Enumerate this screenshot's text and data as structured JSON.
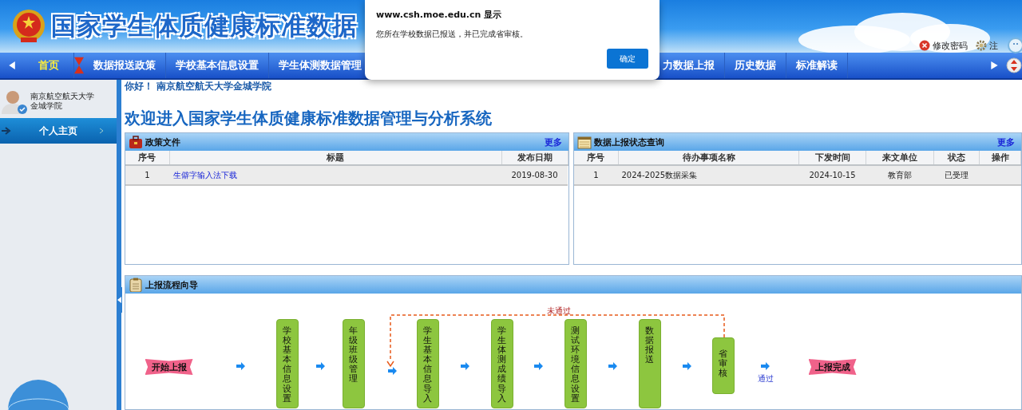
{
  "header": {
    "title": "国家学生体质健康标准数据",
    "links": [
      {
        "label": "修改密码",
        "kind": "password"
      },
      {
        "label": "注",
        "kind": "settings"
      }
    ]
  },
  "dialog": {
    "title": "www.csh.moe.edu.cn 显示",
    "message": "您所在学校数据已报送，并已完成省审核。",
    "button": "确定"
  },
  "nav": {
    "items": [
      {
        "label": "首页",
        "selected": true
      },
      {
        "label": "数据报送政策",
        "selected": false
      },
      {
        "label": "学校基本信息设置",
        "selected": false
      },
      {
        "label": "学生体测数据管理",
        "selected": false
      },
      {
        "label": "力数据上报",
        "selected": false
      },
      {
        "label": "历史数据",
        "selected": false
      },
      {
        "label": "标准解读",
        "selected": false
      }
    ]
  },
  "sidebar": {
    "user": "南京航空航天大学金城学院",
    "items": [
      {
        "label": "个人主页",
        "selected": true
      }
    ]
  },
  "greeting": "你好！ 南京航空航天大学金城学院",
  "heading": "欢迎进入国家学生体质健康标准数据管理与分析系统",
  "panels": [
    {
      "title": "政策文件",
      "kind": "toolbox",
      "more": "更多",
      "columns": [
        {
          "label": "序号",
          "kind": "index"
        },
        {
          "label": "标题",
          "kind": "link"
        },
        {
          "label": "发布日期",
          "kind": "text"
        }
      ],
      "rows": [
        [
          "1",
          "生僻字输入法下载",
          "2019-08-30"
        ]
      ]
    },
    {
      "title": "数据上报状态查询",
      "kind": "calendar",
      "more": "更多",
      "columns": [
        {
          "label": "序号",
          "kind": "index"
        },
        {
          "label": "待办事项名称",
          "kind": "name"
        },
        {
          "label": "下发时间",
          "kind": "text"
        },
        {
          "label": "来文单位",
          "kind": "text"
        },
        {
          "label": "状态",
          "kind": "text"
        },
        {
          "label": "操作",
          "kind": "text"
        }
      ],
      "rows": [
        [
          "1",
          "2024-2025数据采集",
          "2024-10-15",
          "教育部",
          "已受理"
        ]
      ]
    }
  ],
  "flow": {
    "title": "上报流程向导",
    "nodes": [
      {
        "kind": "start",
        "label": "开始上报"
      },
      {
        "kind": "step",
        "label": "学校基本信息设置"
      },
      {
        "kind": "step",
        "label": "年级班级管理"
      },
      {
        "kind": "step",
        "label": "学生基本信息导入"
      },
      {
        "kind": "step",
        "label": "学生体测成绩导入"
      },
      {
        "kind": "step",
        "label": "测试环境信息设置"
      },
      {
        "kind": "step",
        "label": "数据报送"
      },
      {
        "kind": "review",
        "label": "省审核"
      },
      {
        "kind": "end",
        "label": "上报完成"
      }
    ],
    "reject_label": "未通过",
    "pass_label": "通过"
  }
}
